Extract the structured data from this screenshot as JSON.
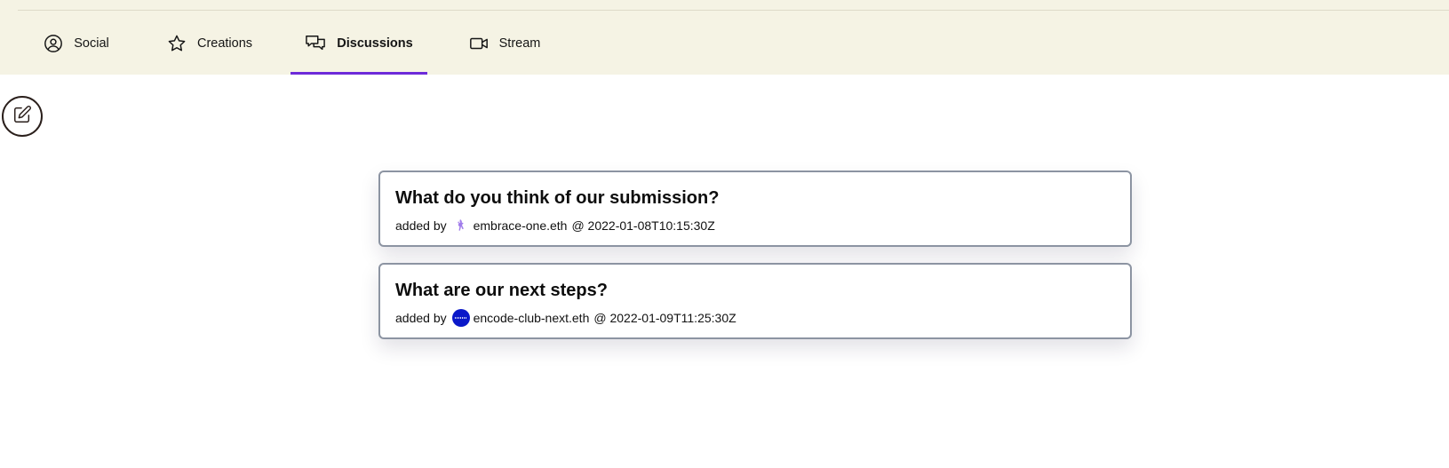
{
  "tabs": [
    {
      "label": "Social",
      "icon": "user-circle-icon",
      "active": false
    },
    {
      "label": "Creations",
      "icon": "star-icon",
      "active": false
    },
    {
      "label": "Discussions",
      "icon": "chat-bubbles-icon",
      "active": true
    },
    {
      "label": "Stream",
      "icon": "video-camera-icon",
      "active": false
    }
  ],
  "colors": {
    "header_bg": "#f5f3e4",
    "active_tab_underline": "#6d2bd9",
    "card_border": "#8c94a2",
    "encode_avatar": "#0a18c9"
  },
  "edit_button": {
    "icon": "pencil-square-icon"
  },
  "discussions": [
    {
      "title": "What do you think of our submission?",
      "added_by_label": "added by",
      "author": "embrace-one.eth",
      "avatar_icon": "embrace-avatar-icon",
      "timestamp": "@ 2022-01-08T10:15:30Z"
    },
    {
      "title": "What are our next steps?",
      "added_by_label": "added by",
      "author": "encode-club-next.eth",
      "avatar_icon": "encode-avatar-icon",
      "timestamp": "@ 2022-01-09T11:25:30Z"
    }
  ]
}
